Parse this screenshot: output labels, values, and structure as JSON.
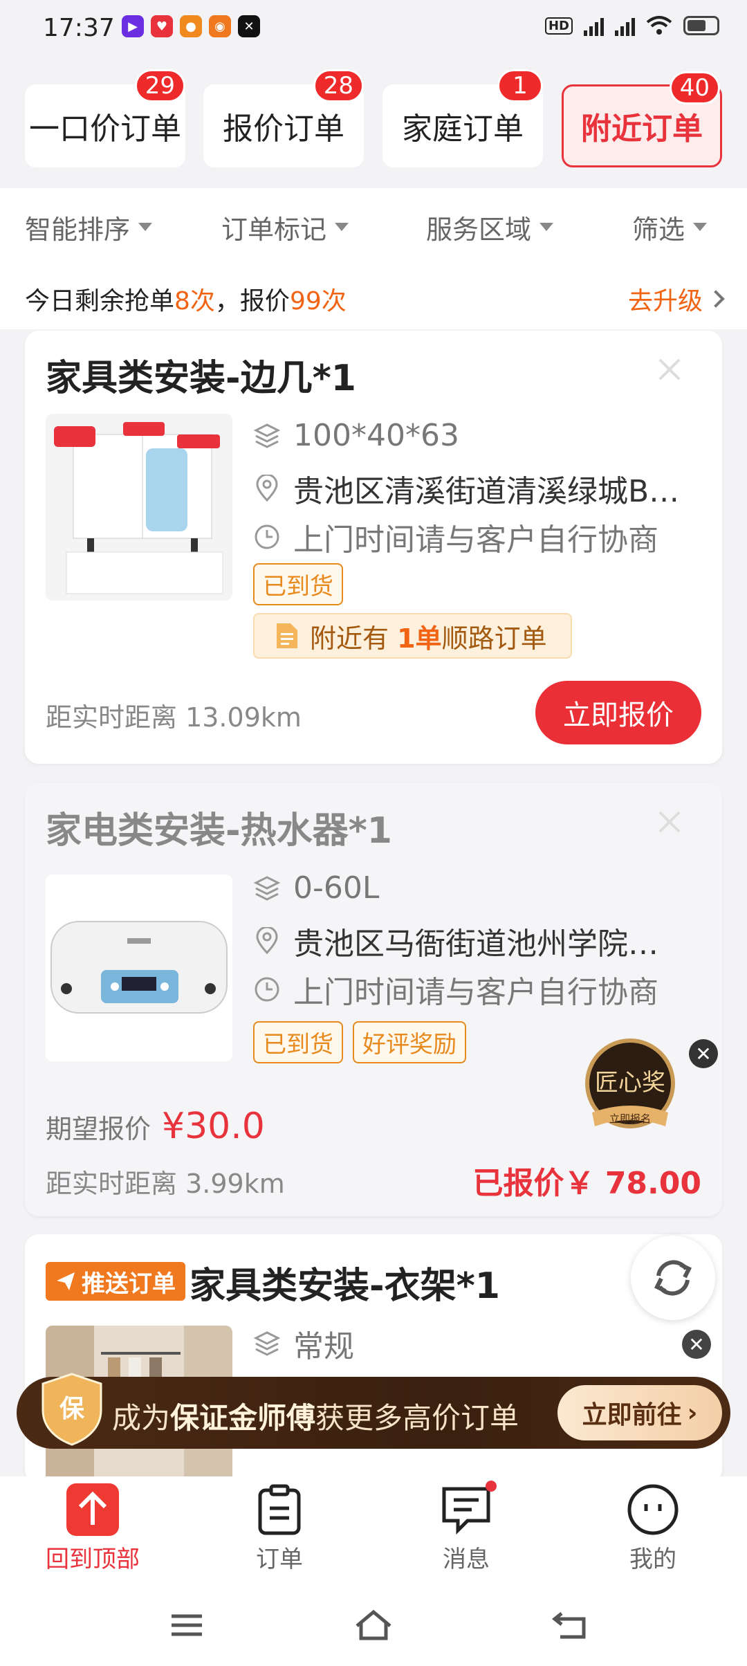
{
  "status": {
    "time": "17:37",
    "right_icons": [
      "hd-icon",
      "5g-signal-icon",
      "5g-signal-icon",
      "wifi-icon",
      "battery-icon"
    ]
  },
  "tabs": [
    {
      "label": "一口价订单",
      "badge": "29",
      "active": false
    },
    {
      "label": "报价订单",
      "badge": "28",
      "active": false
    },
    {
      "label": "家庭订单",
      "badge": "1",
      "active": false
    },
    {
      "label": "附近订单",
      "badge": "40",
      "active": true
    }
  ],
  "filters": [
    "智能排序",
    "订单标记",
    "服务区域",
    "筛选"
  ],
  "quota": {
    "prefix": "今日剩余抢单",
    "grab": "8次",
    "middle": "，报价",
    "quote": "99次",
    "upgrade": "去升级"
  },
  "cards": [
    {
      "title": "家具类安装-边几*1",
      "spec": "100*40*63",
      "address": "贵池区清溪街道清溪绿城B…",
      "time": "上门时间请与客户自行协商",
      "tags": [
        "已到货"
      ],
      "route_prefix": "附近有",
      "route_num": "1单",
      "route_suffix": "顺路订单",
      "distance": "距实时距离 13.09km",
      "action": "立即报价"
    },
    {
      "title": "家电类安装-热水器*1",
      "spec": "0-60L",
      "address": "贵池区马衙街道池州学院…",
      "time": "上门时间请与客户自行协商",
      "tags": [
        "已到货",
        "好评奖励"
      ],
      "expect_label": "期望报价",
      "expect_price": "¥30.0",
      "distance": "距实时距离 3.99km",
      "quoted": "已报价￥ 78.00"
    },
    {
      "push_tag": "推送订单",
      "title": "家具类安装-衣架*1",
      "spec": "常规"
    }
  ],
  "award": {
    "icon": "craftsman-award-icon",
    "label": "匠心奖",
    "cta": "立即报名"
  },
  "banner": {
    "pre": "成为",
    "bold": "保证金师傅",
    "post": "获更多高价订单",
    "go": "立即前往",
    "shield": "保"
  },
  "bottom_nav": [
    {
      "label": "回到顶部",
      "icon": "arrow-up-icon",
      "active": true
    },
    {
      "label": "订单",
      "icon": "clipboard-icon",
      "active": false
    },
    {
      "label": "消息",
      "icon": "message-icon",
      "active": false
    },
    {
      "label": "我的",
      "icon": "profile-icon",
      "active": false
    }
  ],
  "colors": {
    "accent": "#e8323c",
    "orange": "#f06413",
    "tag": "#e8891d"
  }
}
